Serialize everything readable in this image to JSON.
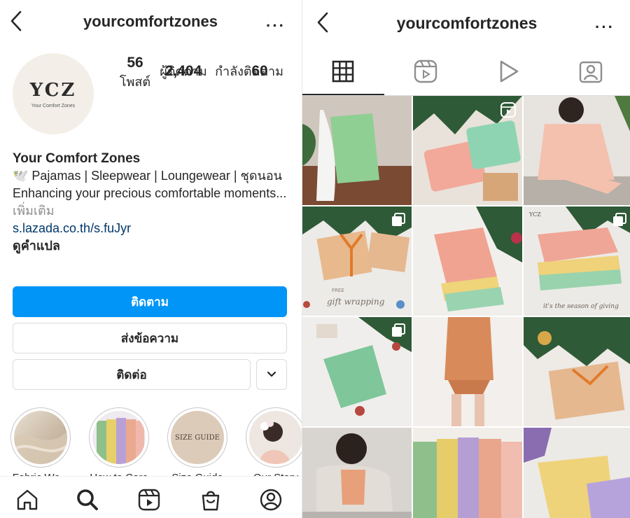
{
  "left": {
    "username": "yourcomfortzones",
    "more_label": "···",
    "avatar": {
      "monogram": "YCZ",
      "subtitle": "Your Comfort Zones"
    },
    "stats": [
      {
        "num": "56",
        "label": "โพสต์"
      },
      {
        "num": "2,404",
        "label": "ผู้ติดตาม"
      },
      {
        "num": "60",
        "label": "กำลังติดตาม"
      }
    ],
    "bio": {
      "name": "Your Comfort Zones",
      "line1": "🕊️ Pajamas | Sleepwear | Loungewear | ชุดนอน",
      "line2": "Enhancing your precious comfortable moments...",
      "more": "เพิ่มเติม",
      "link": "s.lazada.co.th/s.fuJyr",
      "translate": "ดูคำแปล"
    },
    "buttons": {
      "follow": "ติดตาม",
      "message": "ส่งข้อความ",
      "contact": "ติดต่อ"
    },
    "highlights": [
      {
        "label": "Fabric We..."
      },
      {
        "label": "How to Care"
      },
      {
        "label": "Size Guide",
        "cover_text": "SIZE GUIDE"
      },
      {
        "label": "Our Story"
      }
    ]
  },
  "right": {
    "username": "yourcomfortzones",
    "more_label": "···",
    "grid_captions": {
      "gift": "gift wrapping",
      "gift_free": "FREE",
      "season": "it's the season of giving",
      "ycz": "YCZ"
    }
  },
  "colors": {
    "primary": "#0095f6",
    "link": "#00376b",
    "text": "#262626",
    "muted": "#8e8e8e",
    "border": "#dbdbdb"
  }
}
